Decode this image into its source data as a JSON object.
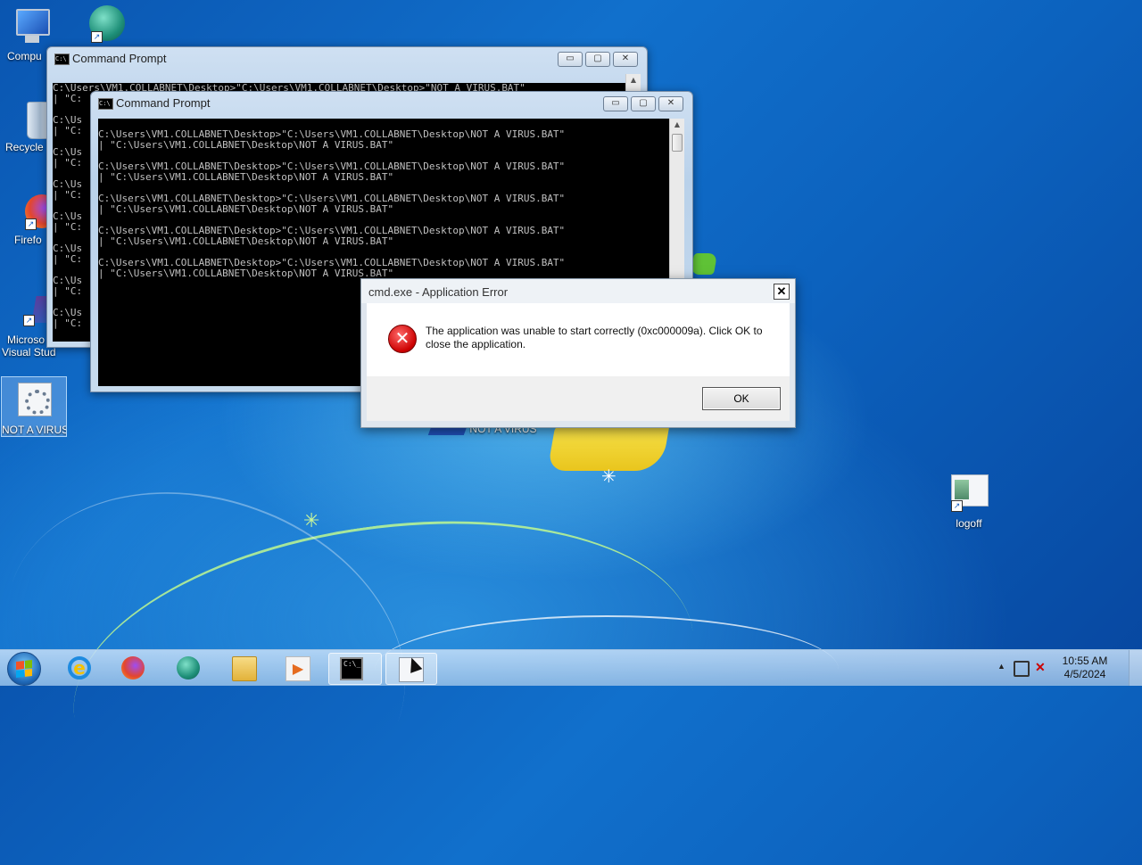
{
  "desktop": {
    "icons": [
      {
        "label": "Compu",
        "name": "desktop-icon-computer"
      },
      {
        "label": "",
        "name": "desktop-icon-app"
      },
      {
        "label": "Recycle",
        "name": "desktop-icon-recycle-bin"
      },
      {
        "label": "Firefo",
        "name": "desktop-icon-firefox"
      },
      {
        "label": "Microso",
        "label2": "Visual Stud",
        "name": "desktop-icon-visual-studio"
      },
      {
        "label": "NOT A VIRUS",
        "name": "desktop-icon-not-a-virus"
      },
      {
        "label": "NOT A VIRUS",
        "name": "desktop-icon-not-a-virus-2"
      },
      {
        "label": "logoff",
        "name": "desktop-icon-logoff"
      }
    ]
  },
  "back_window": {
    "title": "Command Prompt",
    "buttons": {
      "minimize": "▭",
      "maximize": "▢",
      "close": "✕"
    },
    "lines": "C:\\Users\\VM1.COLLABNET\\Desktop>\"C:\\Users\\VM1.COLLABNET\\Desktop>\"NOT A VIRUS.BAT\"\n| \"C:\n\nC:\\Us\n| \"C:\n\nC:\\Us\n| \"C:\n\nC:\\Us\n| \"C:\n\nC:\\Us\n| \"C:\n\nC:\\Us\n| \"C:\n\nC:\\Us\n| \"C:\n\nC:\\Us\n| \"C:"
  },
  "front_window": {
    "title": "Command Prompt",
    "buttons": {
      "minimize": "▭",
      "maximize": "▢",
      "close": "✕"
    },
    "lines": "C:\\Users\\VM1.COLLABNET\\Desktop>\"C:\\Users\\VM1.COLLABNET\\Desktop\\NOT A VIRUS.BAT\"\n| \"C:\\Users\\VM1.COLLABNET\\Desktop\\NOT A VIRUS.BAT\"\n\nC:\\Users\\VM1.COLLABNET\\Desktop>\"C:\\Users\\VM1.COLLABNET\\Desktop\\NOT A VIRUS.BAT\"\n| \"C:\\Users\\VM1.COLLABNET\\Desktop\\NOT A VIRUS.BAT\"\n\nC:\\Users\\VM1.COLLABNET\\Desktop>\"C:\\Users\\VM1.COLLABNET\\Desktop\\NOT A VIRUS.BAT\"\n| \"C:\\Users\\VM1.COLLABNET\\Desktop\\NOT A VIRUS.BAT\"\n\nC:\\Users\\VM1.COLLABNET\\Desktop>\"C:\\Users\\VM1.COLLABNET\\Desktop\\NOT A VIRUS.BAT\"\n| \"C:\\Users\\VM1.COLLABNET\\Desktop\\NOT A VIRUS.BAT\"\n\nC:\\Users\\VM1.COLLABNET\\Desktop>\"C:\\Users\\VM1.COLLABNET\\Desktop\\NOT A VIRUS.BAT\"\n| \"C:\\Users\\VM1.COLLABNET\\Desktop\\NOT A VIRUS.BAT\""
  },
  "dialog": {
    "title": "cmd.exe - Application Error",
    "close": "✕",
    "icon": "error-icon",
    "message": "The application was unable to start correctly (0xc000009a). Click OK to close the application.",
    "ok_label": "OK"
  },
  "taskbar": {
    "items": [
      "start-button",
      "internet-explorer",
      "firefox",
      "app",
      "file-explorer",
      "media-player",
      "command-prompt",
      "not-a-virus"
    ],
    "tray": {
      "time": "10:55 AM",
      "date": "4/5/2024",
      "show_hidden": "▲"
    }
  }
}
